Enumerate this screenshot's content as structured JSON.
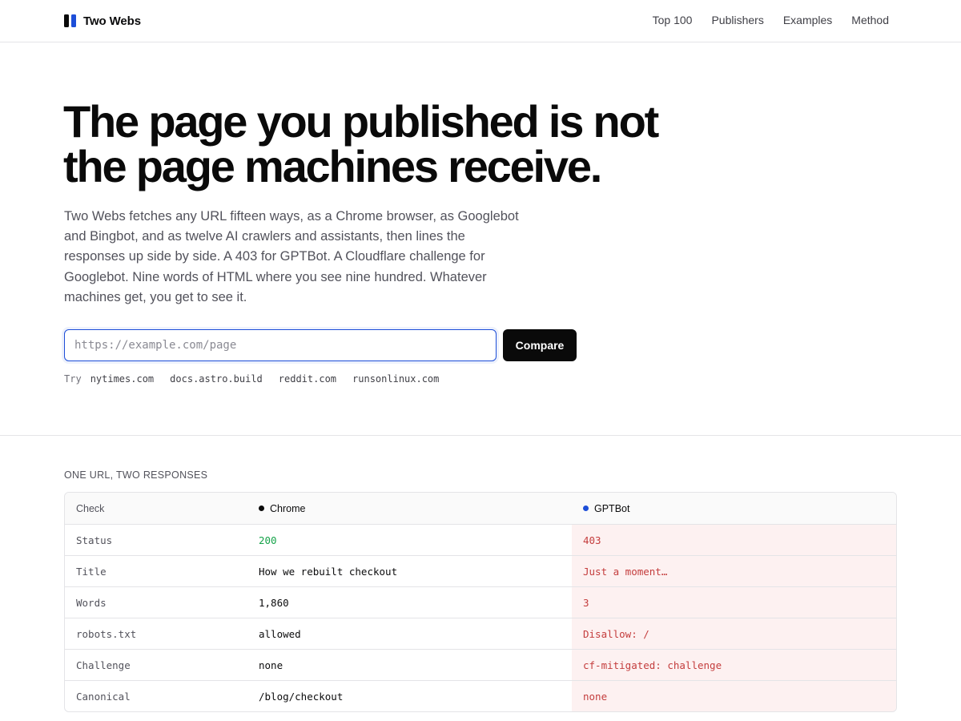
{
  "header": {
    "brand": "Two Webs",
    "logo_colors": [
      "#0a0a0a",
      "#1d4ed8"
    ],
    "nav": [
      "Top 100",
      "Publishers",
      "Examples",
      "Method"
    ]
  },
  "hero": {
    "title_line1": "The page you published is not",
    "title_line2": "the page machines receive.",
    "description": "Two Webs fetches any URL fifteen ways, as a Chrome browser, as Googlebot and Bingbot, and as twelve AI crawlers and assistants, then lines the responses up side by side. A 403 for GPTBot. A Cloudflare challenge for Googlebot. Nine words of HTML where you see nine hundred. Whatever machines get, you get to see it.",
    "input_placeholder": "https://example.com/page",
    "input_value": "",
    "button": "Compare",
    "try_label": "Try",
    "try_links": [
      "nytimes.com",
      "docs.astro.build",
      "reddit.com",
      "runsonlinux.com"
    ]
  },
  "comparison": {
    "section_label": "ONE URL, TWO RESPONSES",
    "headers": {
      "check": "Check",
      "a": "Chrome",
      "b": "GPTBot"
    },
    "a_dot_color": "#0a0a0a",
    "b_dot_color": "#1d4ed8",
    "rows": [
      {
        "check": "Status",
        "a": "200",
        "b": "403"
      },
      {
        "check": "Title",
        "a": "How we rebuilt checkout",
        "b": "Just a moment…"
      },
      {
        "check": "Words",
        "a": "1,860",
        "b": "3"
      },
      {
        "check": "robots.txt",
        "a": "allowed",
        "b": "Disallow: /"
      },
      {
        "check": "Challenge",
        "a": "none",
        "b": "cf-mitigated: challenge"
      },
      {
        "check": "Canonical",
        "a": "/blog/checkout",
        "b": "none"
      }
    ]
  }
}
